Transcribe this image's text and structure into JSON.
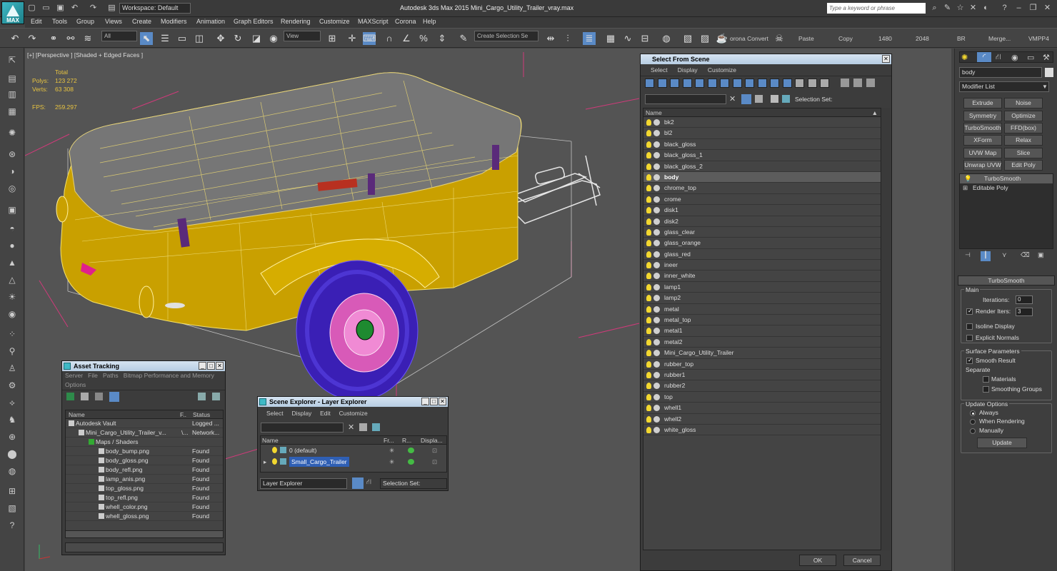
{
  "app": {
    "logo_label": "MAX",
    "title": "Autodesk 3ds Max  2015     Mini_Cargo_Utility_Trailer_vray.max",
    "workspace": "Workspace: Default",
    "search_placeholder": "Type a keyword or phrase"
  },
  "menus": [
    "Edit",
    "Tools",
    "Group",
    "Views",
    "Create",
    "Modifiers",
    "Animation",
    "Graph Editors",
    "Rendering",
    "Customize",
    "MAXScript",
    "Corona",
    "Help"
  ],
  "toolbar": {
    "filter": "All",
    "view": "View",
    "selection_set": "Create Selection Se",
    "corona_convert": "orona Convert",
    "paste": "Paste",
    "copy": "Copy",
    "n1480": "1480",
    "n2048": "2048",
    "br": "BR",
    "merge": "Merge...",
    "vmpp4": "VMPP4"
  },
  "viewport": {
    "label": "[+] [Perspective ] [Shaded + Edged Faces ]",
    "stats": {
      "total": "Total",
      "polys_label": "Polys:",
      "polys": "123 272",
      "verts_label": "Verts:",
      "verts": "63 308",
      "fps_label": "FPS:",
      "fps": "259.297"
    }
  },
  "select_from_scene": {
    "title": "Select From Scene",
    "menus": [
      "Select",
      "Display",
      "Customize"
    ],
    "selection_set_label": "Selection Set:",
    "column_name": "Name",
    "items": [
      "bk2",
      "bl2",
      "black_gloss",
      "black_gloss_1",
      "black_gloss_2",
      "body",
      "chrome_top",
      "crome",
      "disk1",
      "disk2",
      "glass_clear",
      "glass_orange",
      "glass_red",
      "ineer",
      "inner_white",
      "lamp1",
      "lamp2",
      "metal",
      "metal_top",
      "metal1",
      "metal2",
      "Mini_Cargo_Utility_Trailer",
      "rubber_top",
      "rubber1",
      "rubber2",
      "top",
      "whell1",
      "whell2",
      "white_gloss"
    ],
    "selected": "body",
    "ok": "OK",
    "cancel": "Cancel"
  },
  "asset_tracking": {
    "title": "Asset Tracking",
    "menus": [
      "Server",
      "File",
      "Paths",
      "Bitmap Performance and Memory"
    ],
    "menu2": "Options",
    "col_name": "Name",
    "col_f": "F..",
    "col_status": "Status",
    "rows": [
      {
        "name": "Autodesk Vault",
        "status": "Logged ..."
      },
      {
        "name": "Mini_Cargo_Utility_Trailer_v...",
        "f": "\\...",
        "status": "Network..."
      },
      {
        "name": "Maps / Shaders",
        "status": ""
      },
      {
        "name": "body_bump.png",
        "status": "Found"
      },
      {
        "name": "body_gloss.png",
        "status": "Found"
      },
      {
        "name": "body_refl.png",
        "status": "Found"
      },
      {
        "name": "lamp_anis.png",
        "status": "Found"
      },
      {
        "name": "top_gloss.png",
        "status": "Found"
      },
      {
        "name": "top_refl.png",
        "status": "Found"
      },
      {
        "name": "whell_color.png",
        "status": "Found"
      },
      {
        "name": "whell_gloss.png",
        "status": "Found"
      }
    ]
  },
  "scene_explorer": {
    "title": "Scene Explorer - Layer Explorer",
    "menus": [
      "Select",
      "Display",
      "Edit",
      "Customize"
    ],
    "col_name": "Name",
    "col_fr": "Fr...",
    "col_r": "R...",
    "col_display": "Displa...",
    "layers": [
      "0 (default)",
      "Small_Cargo_Trailer"
    ],
    "footer_dropdown": "Layer Explorer",
    "footer_selset": "Selection Set:"
  },
  "modify_panel": {
    "object_name": "body",
    "modifier_list": "Modifier List",
    "buttons": [
      "Extrude",
      "Noise",
      "Symmetry",
      "Optimize",
      "TurboSmooth",
      "FFD(box)",
      "XForm",
      "Relax",
      "UVW Map",
      "Slice",
      "Unwrap UVW",
      "Edit Poly"
    ],
    "stack": [
      "TurboSmooth",
      "Editable Poly"
    ],
    "rollout_title": "TurboSmooth",
    "main": "Main",
    "iterations_label": "Iterations:",
    "iterations": "0",
    "render_iters_label": "Render Iters:",
    "render_iters": "3",
    "isoline": "Isoline Display",
    "explicit_normals": "Explicit Normals",
    "surface_params": "Surface Parameters",
    "smooth_result": "Smooth Result",
    "separate": "Separate",
    "materials": "Materials",
    "smoothing_groups": "Smoothing Groups",
    "update_options": "Update Options",
    "always": "Always",
    "when_rendering": "When Rendering",
    "manually": "Manually",
    "update": "Update"
  }
}
